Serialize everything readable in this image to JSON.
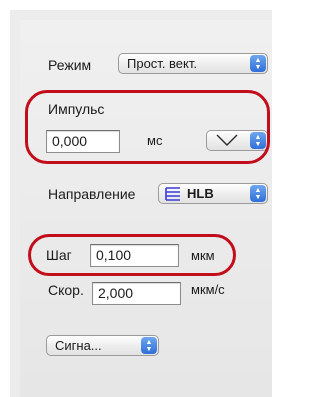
{
  "mode": {
    "label": "Режим",
    "value": "Прост. вект."
  },
  "pulse": {
    "title": "Импульс",
    "value": "0,000",
    "unit": "мс",
    "shape_value": "\\/"
  },
  "direction": {
    "label": "Направление",
    "value": "HLB"
  },
  "step": {
    "label": "Шаг",
    "value": "0,100",
    "unit": "мкм"
  },
  "speed": {
    "label": "Скор.",
    "value": "2,000",
    "unit": "мкм/с"
  },
  "signal": {
    "value": "Сигна..."
  },
  "colors": {
    "highlight": "#c20e1a",
    "stepper": "#3b7be0"
  }
}
